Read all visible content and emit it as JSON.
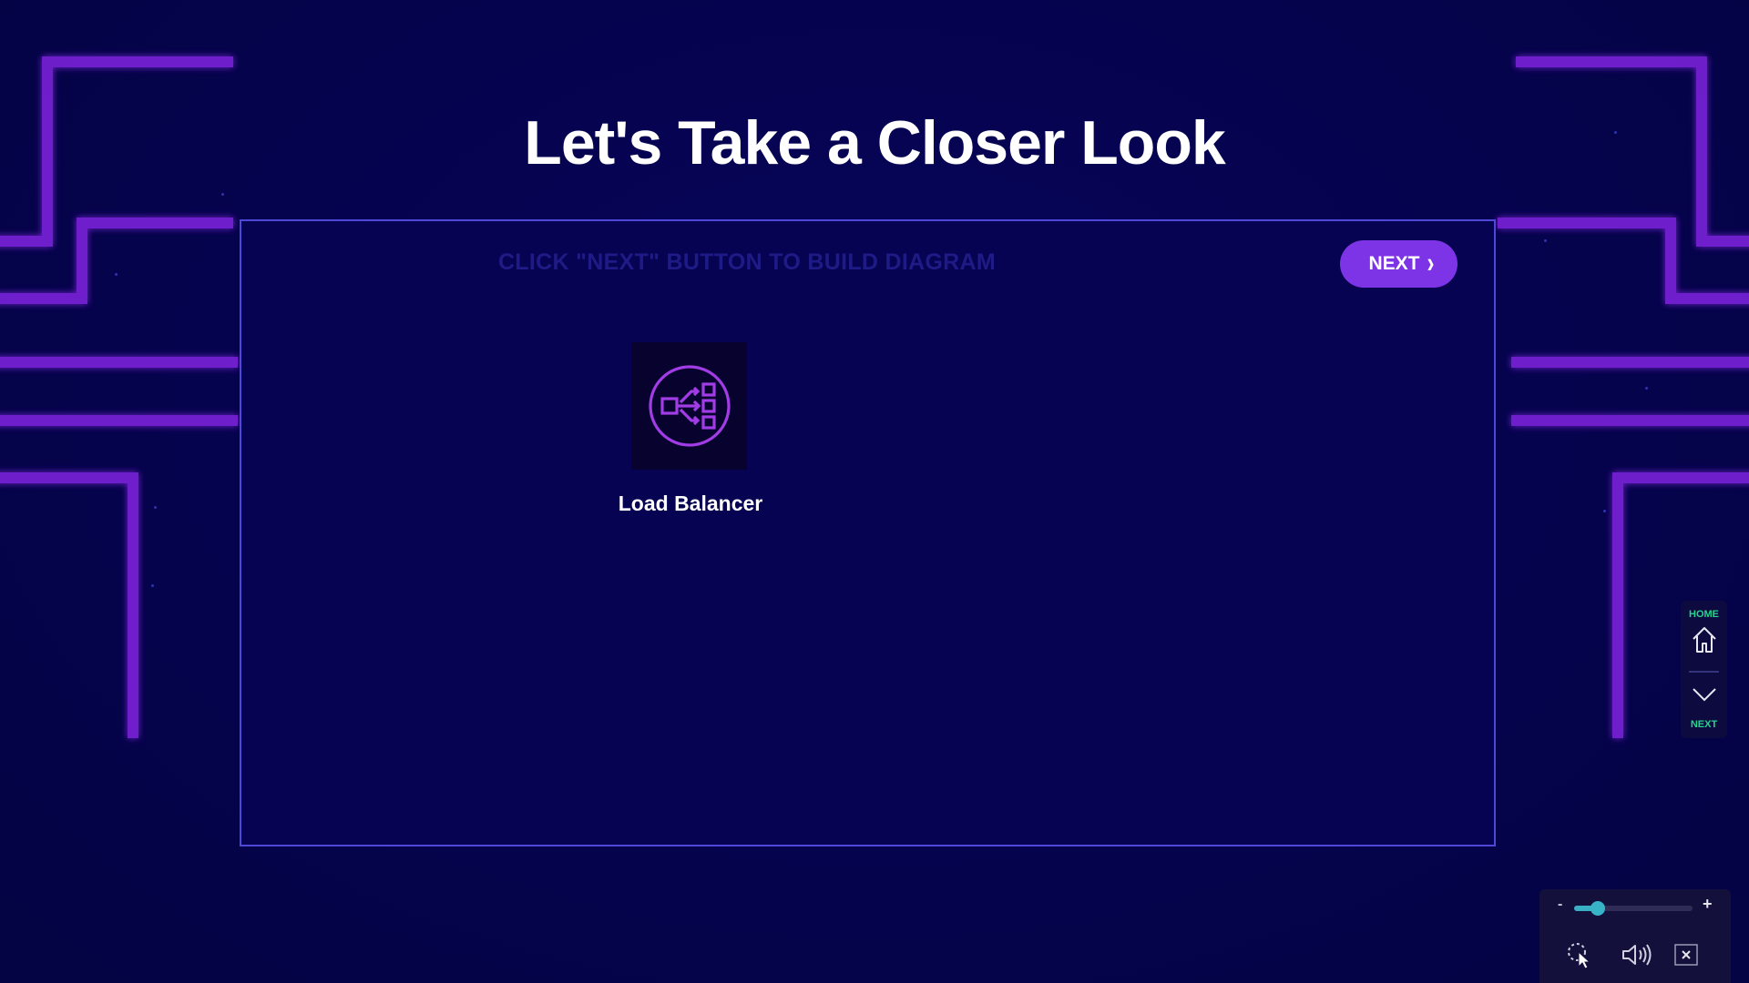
{
  "slide": {
    "title": "Let's Take a Closer Look",
    "instruction": "CLICK \"NEXT\" BUTTON TO BUILD DIAGRAM",
    "next_button_label": "NEXT"
  },
  "diagram": {
    "nodes": [
      {
        "label": "Load Balancer",
        "icon": "load-balancer-icon"
      }
    ]
  },
  "side_nav": {
    "home_label": "HOME",
    "next_label": "NEXT"
  },
  "player": {
    "zoom_minus": "-",
    "zoom_plus": "+",
    "zoom_level": 0.2
  },
  "colors": {
    "background": "#05034d",
    "panel_border": "#4e47d8",
    "accent_purple": "#7d34e6",
    "circuit_purple": "#8a2be2",
    "nav_green": "#25d48c",
    "slider_teal": "#38b4c8"
  }
}
